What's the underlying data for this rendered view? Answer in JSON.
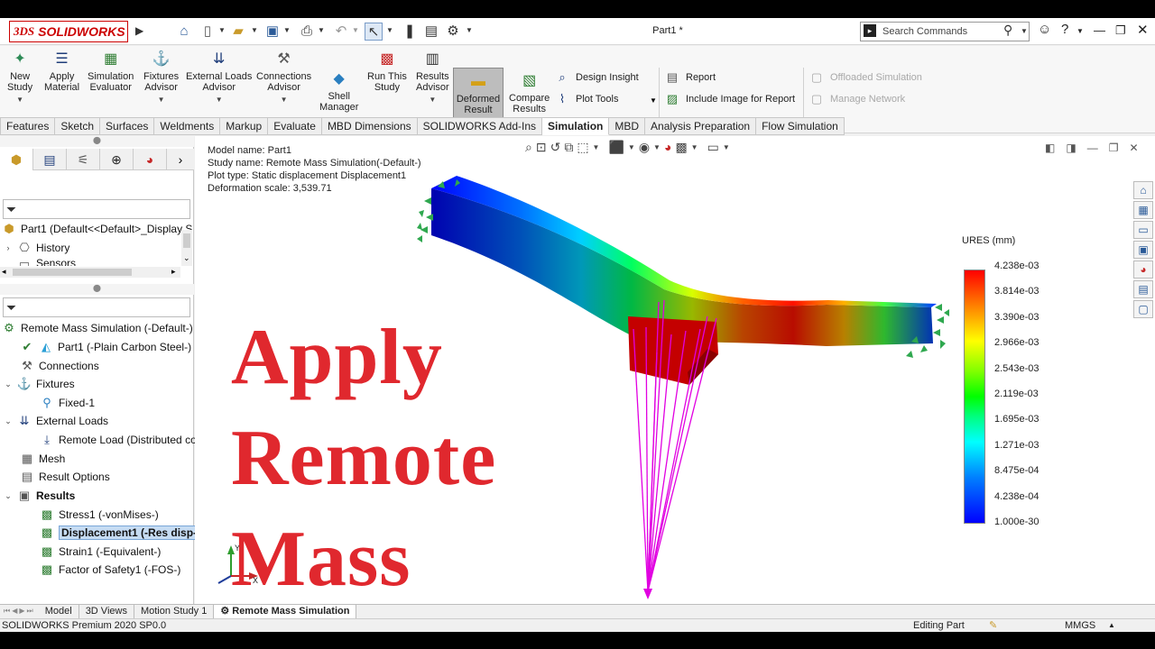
{
  "app": {
    "brand_prefix": "3DS",
    "brand": "SOLIDWORKS",
    "document_title": "Part1 *"
  },
  "search": {
    "placeholder": "Search Commands"
  },
  "commands": {
    "new_study": [
      "New",
      "Study"
    ],
    "apply_material": [
      "Apply",
      "Material"
    ],
    "simulation_evaluator": [
      "Simulation",
      "Evaluator"
    ],
    "fixtures_advisor": [
      "Fixtures",
      "Advisor"
    ],
    "external_loads_advisor": [
      "External Loads",
      "Advisor"
    ],
    "connections_advisor": [
      "Connections",
      "Advisor"
    ],
    "shell_manager": [
      "Shell",
      "Manager"
    ],
    "run_this_study": [
      "Run This",
      "Study"
    ],
    "results_advisor": [
      "Results",
      "Advisor"
    ],
    "deformed_result": [
      "Deformed",
      "Result"
    ],
    "compare_results": [
      "Compare",
      "Results"
    ],
    "design_insight": "Design Insight",
    "plot_tools": "Plot Tools",
    "report": "Report",
    "include_image": "Include Image for Report",
    "offloaded_simulation": "Offloaded Simulation",
    "manage_network": "Manage Network"
  },
  "tabs": [
    "Features",
    "Sketch",
    "Surfaces",
    "Weldments",
    "Markup",
    "Evaluate",
    "MBD Dimensions",
    "SOLIDWORKS Add-Ins",
    "Simulation",
    "MBD",
    "Analysis Preparation",
    "Flow Simulation"
  ],
  "selected_tab": "Simulation",
  "feature_tree": {
    "part": "Part1  (Default<<Default>_Display S",
    "history": "History",
    "sensors": "Sensors"
  },
  "sim_tree": {
    "study": "Remote Mass Simulation (-Default-)",
    "part": "Part1 (-Plain Carbon Steel-)",
    "connections": "Connections",
    "fixtures": "Fixtures",
    "fixed": "Fixed-1",
    "external_loads": "External Loads",
    "remote_load": "Remote Load (Distributed con",
    "mesh": "Mesh",
    "result_options": "Result Options",
    "results": "Results",
    "stress": "Stress1 (-vonMises-)",
    "displacement": "Displacement1 (-Res disp-)",
    "strain": "Strain1 (-Equivalent-)",
    "fos": "Factor of Safety1 (-FOS-)"
  },
  "plot_info": {
    "model_name": "Model name: Part1",
    "study_name": "Study name: Remote Mass Simulation(-Default-)",
    "plot_type": "Plot type: Static displacement Displacement1",
    "deformation_scale": "Deformation scale: 3,539.71"
  },
  "overlay_text": [
    "Apply",
    "Remote",
    "Mass"
  ],
  "legend": {
    "title": "URES (mm)",
    "labels": [
      "4.238e-03",
      "3.814e-03",
      "3.390e-03",
      "2.966e-03",
      "2.543e-03",
      "2.119e-03",
      "1.695e-03",
      "1.271e-03",
      "8.475e-04",
      "4.238e-04",
      "1.000e-30"
    ]
  },
  "triad": {
    "x": "X",
    "y": "Y"
  },
  "bottom_tabs": [
    "Model",
    "3D Views",
    "Motion Study 1",
    "Remote Mass Simulation"
  ],
  "status": {
    "product": "SOLIDWORKS Premium 2020 SP0.0",
    "mode": "Editing Part",
    "units": "MMGS"
  },
  "colors": {
    "overlay": "#e0282e",
    "accent": "#c00000",
    "legend_top": "#ff0000",
    "legend_bottom": "#0000ff",
    "remote_link": "#e100e1"
  }
}
